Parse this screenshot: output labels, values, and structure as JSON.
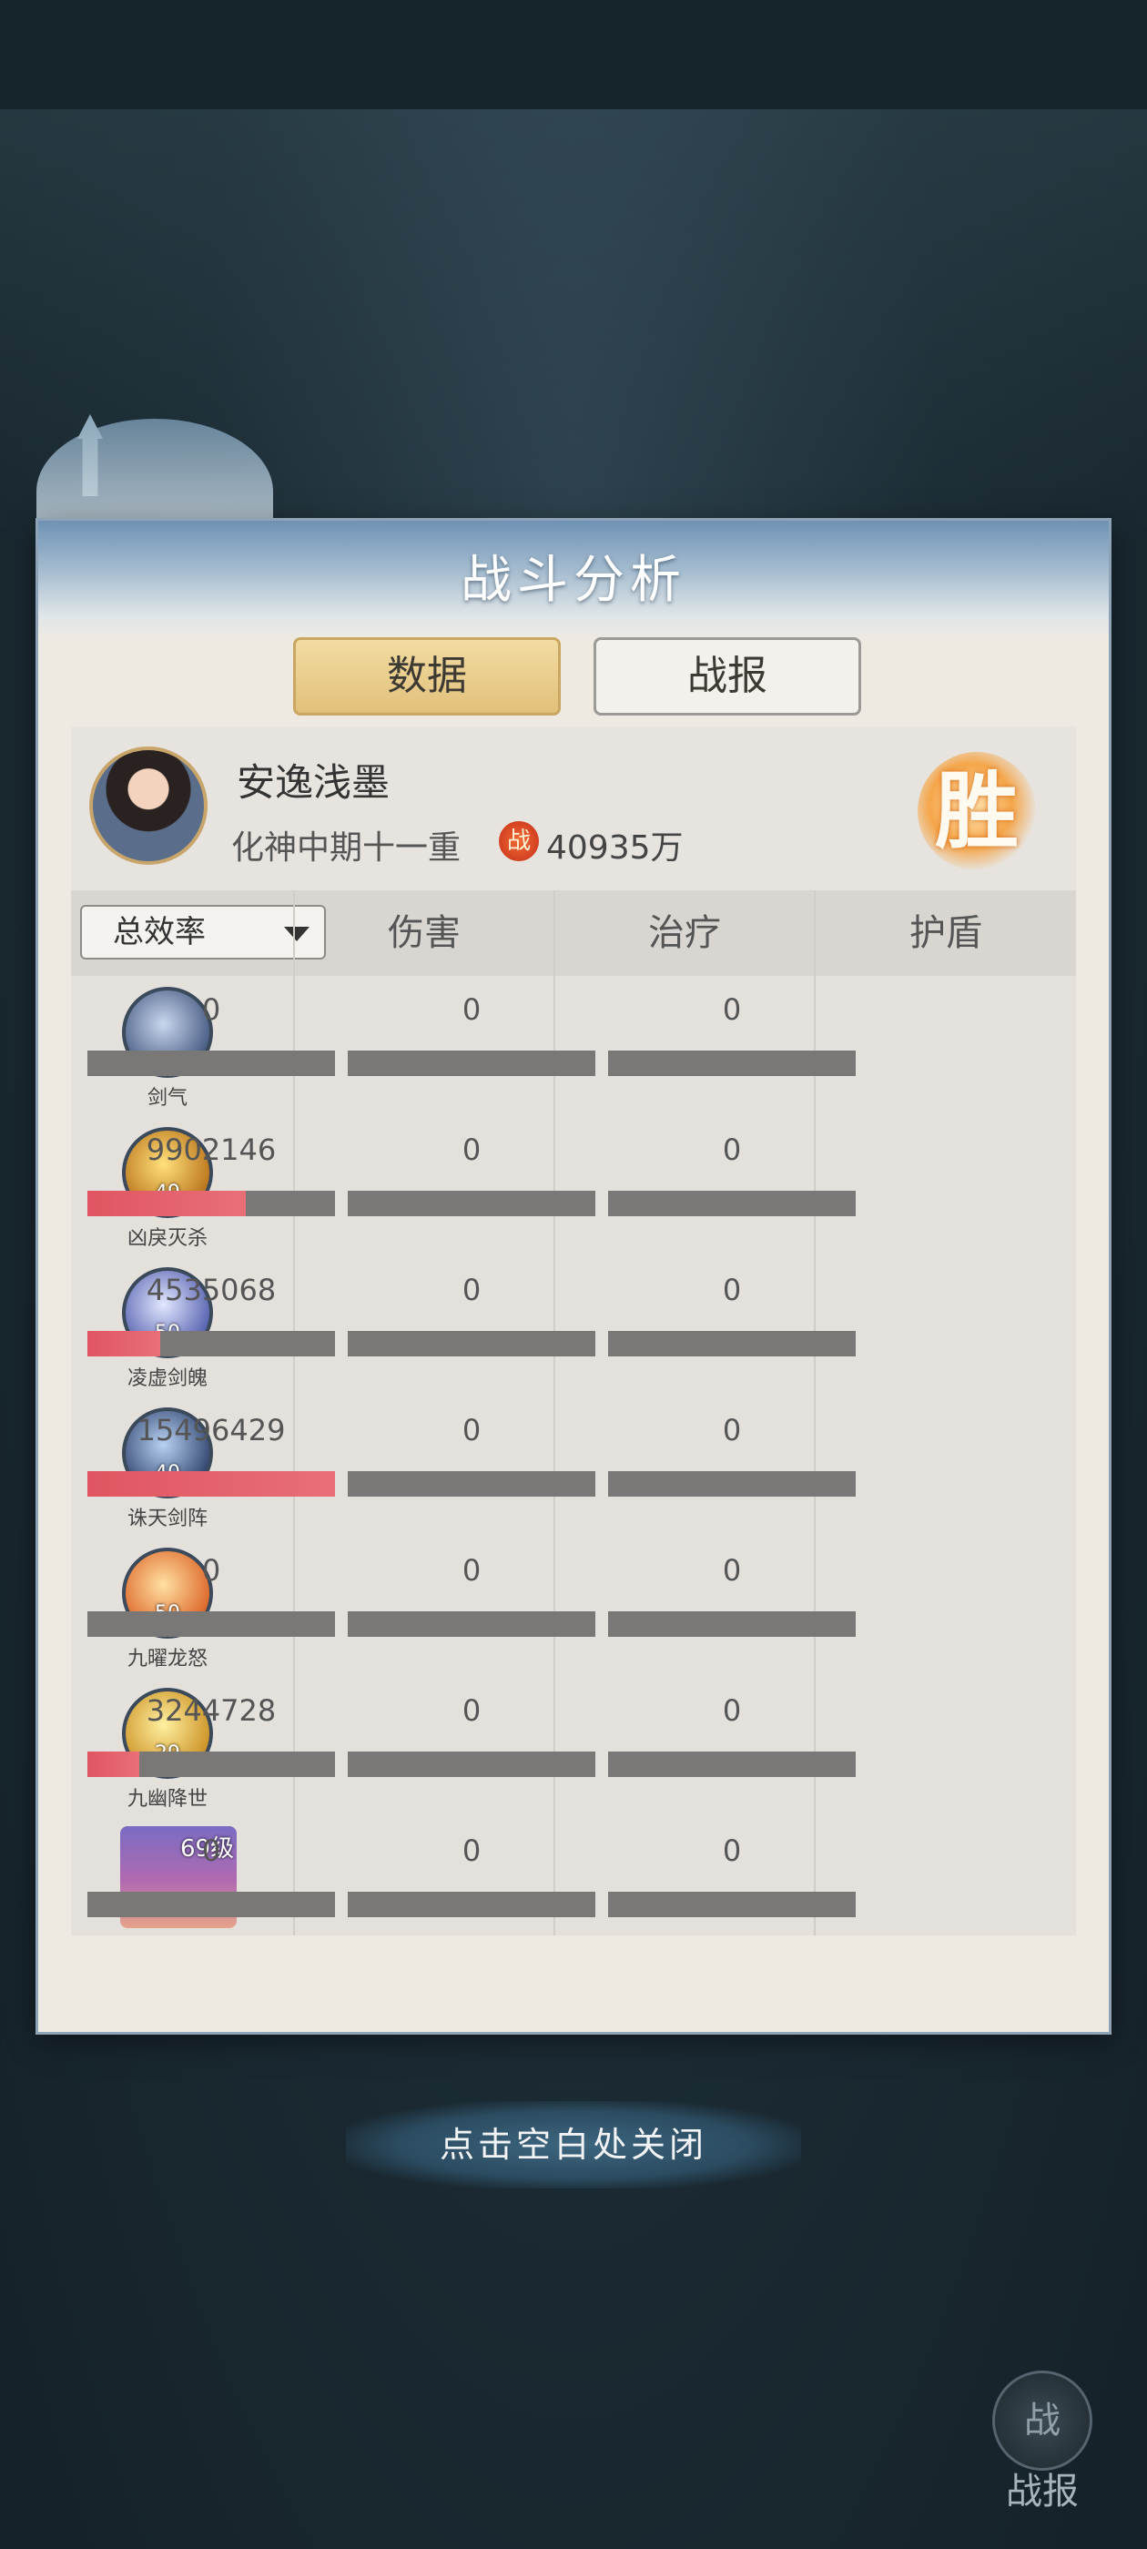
{
  "window": {
    "title": "战斗分析"
  },
  "tabs": {
    "data_label": "数据",
    "report_label": "战报",
    "active": "数据"
  },
  "player": {
    "name": "安逸浅墨",
    "rank": "化神中期十一重",
    "power_icon": "战",
    "power_value": "40935万",
    "result": "胜"
  },
  "table": {
    "filter_label": "总效率",
    "columns": [
      "伤害",
      "治疗",
      "护盾"
    ],
    "rows": [
      {
        "name": "剑气",
        "level": "",
        "damage": "0",
        "heal": "0",
        "shield": "0",
        "damage_ratio": 0,
        "icon": "sword-qi-icon",
        "colors": [
          "#c9d7ee",
          "#3b4f78"
        ]
      },
      {
        "name": "凶戾灭杀",
        "level": "49",
        "damage": "9902146",
        "heal": "0",
        "shield": "0",
        "damage_ratio": 0.639,
        "icon": "fierce-slaughter-icon",
        "colors": [
          "#ffe07a",
          "#b36a12"
        ]
      },
      {
        "name": "凌虚剑魄",
        "level": "50",
        "damage": "4535068",
        "heal": "0",
        "shield": "0",
        "damage_ratio": 0.293,
        "icon": "void-sword-soul-icon",
        "colors": [
          "#e2e8ff",
          "#4a55a8"
        ]
      },
      {
        "name": "诛天剑阵",
        "level": "40",
        "damage": "15496429",
        "heal": "0",
        "shield": "0",
        "damage_ratio": 1.0,
        "icon": "heaven-slaying-array-icon",
        "colors": [
          "#b7d2f2",
          "#283a66"
        ]
      },
      {
        "name": "九曜龙怒",
        "level": "50",
        "damage": "0",
        "heal": "0",
        "shield": "0",
        "damage_ratio": 0,
        "icon": "nine-luminaries-dragon-icon",
        "colors": [
          "#ffe1a3",
          "#d95a1c"
        ]
      },
      {
        "name": "九幽降世",
        "level": "29",
        "damage": "3244728",
        "heal": "0",
        "shield": "0",
        "damage_ratio": 0.209,
        "icon": "nine-netherworld-icon",
        "colors": [
          "#fff0a0",
          "#c7891a"
        ]
      }
    ],
    "pet": {
      "level": "69级",
      "damage": "0",
      "heal": "0",
      "shield": "0",
      "icon": "pet-avatar-icon"
    }
  },
  "footer": {
    "close_hint": "点击空白处关闭",
    "report_button": "战报",
    "report_icon_glyph": "战"
  }
}
